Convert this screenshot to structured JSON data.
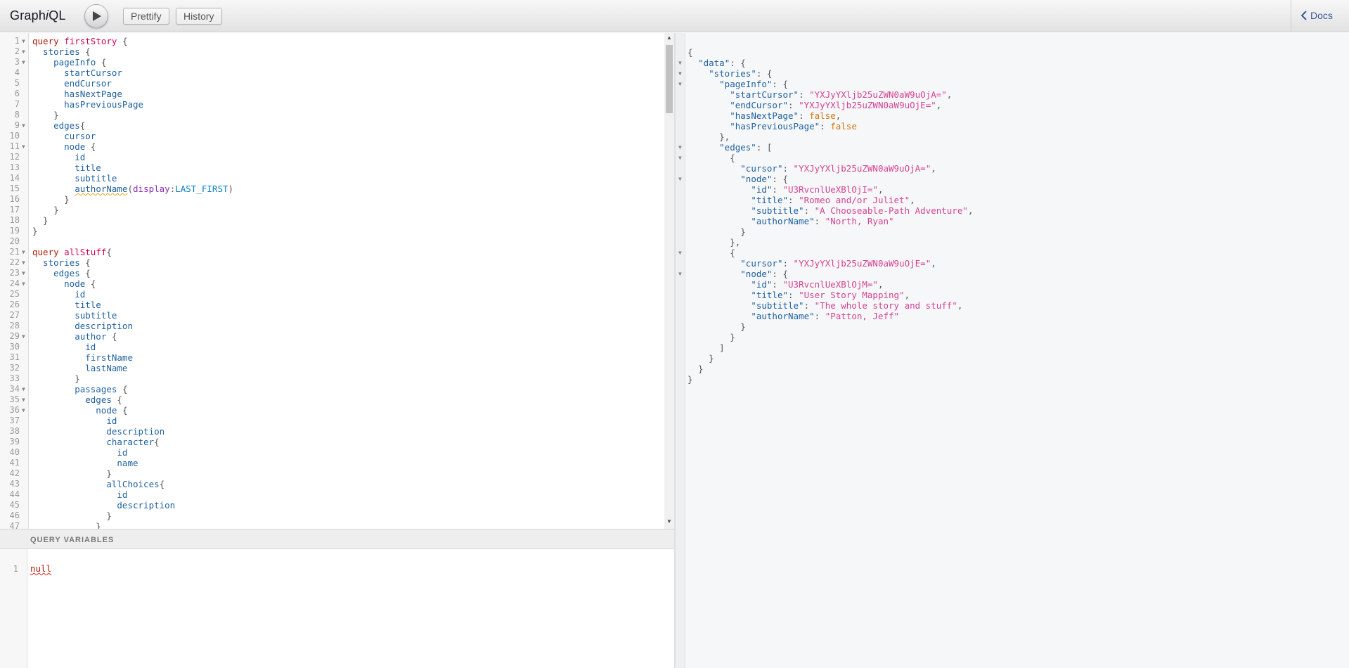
{
  "app": {
    "title_prefix": "Graph",
    "title_i": "i",
    "title_suffix": "QL"
  },
  "toolbar": {
    "prettify_label": "Prettify",
    "history_label": "History",
    "docs_label": "Docs"
  },
  "query_editor": {
    "lines": [
      {
        "n": "1",
        "fold": true,
        "tokens": [
          [
            "kw",
            "query"
          ],
          [
            "",
            " "
          ],
          [
            "def",
            "firstStory"
          ],
          [
            "pn",
            " {"
          ]
        ]
      },
      {
        "n": "2",
        "fold": true,
        "tokens": [
          [
            "",
            "  stories"
          ],
          [
            "pn",
            " {"
          ]
        ]
      },
      {
        "n": "3",
        "fold": true,
        "tokens": [
          [
            "",
            "    pageInfo"
          ],
          [
            "pn",
            " {"
          ]
        ]
      },
      {
        "n": "4",
        "fold": false,
        "tokens": [
          [
            "",
            "      startCursor"
          ]
        ]
      },
      {
        "n": "5",
        "fold": false,
        "tokens": [
          [
            "",
            "      endCursor"
          ]
        ]
      },
      {
        "n": "6",
        "fold": false,
        "tokens": [
          [
            "",
            "      hasNextPage"
          ]
        ]
      },
      {
        "n": "7",
        "fold": false,
        "tokens": [
          [
            "",
            "      hasPreviousPage"
          ]
        ]
      },
      {
        "n": "8",
        "fold": false,
        "tokens": [
          [
            "pn",
            "    }"
          ]
        ]
      },
      {
        "n": "9",
        "fold": true,
        "tokens": [
          [
            "",
            "    edges"
          ],
          [
            "pn",
            "{"
          ]
        ]
      },
      {
        "n": "10",
        "fold": false,
        "tokens": [
          [
            "",
            "      cursor"
          ]
        ]
      },
      {
        "n": "11",
        "fold": true,
        "tokens": [
          [
            "",
            "      node"
          ],
          [
            "pn",
            " {"
          ]
        ]
      },
      {
        "n": "12",
        "fold": false,
        "tokens": [
          [
            "",
            "        id"
          ]
        ]
      },
      {
        "n": "13",
        "fold": false,
        "tokens": [
          [
            "",
            "        title"
          ]
        ]
      },
      {
        "n": "14",
        "fold": false,
        "tokens": [
          [
            "",
            "        subtitle"
          ]
        ]
      },
      {
        "n": "15",
        "fold": false,
        "tokens": [
          [
            "",
            "        "
          ],
          [
            "err",
            "authorName"
          ],
          [
            "pn",
            "("
          ],
          [
            "arg",
            "display"
          ],
          [
            "pn",
            ":"
          ],
          [
            "en",
            "LAST_FIRST"
          ],
          [
            "pn",
            ")"
          ]
        ]
      },
      {
        "n": "16",
        "fold": false,
        "tokens": [
          [
            "pn",
            "      }"
          ]
        ]
      },
      {
        "n": "17",
        "fold": false,
        "tokens": [
          [
            "pn",
            "    }"
          ]
        ]
      },
      {
        "n": "18",
        "fold": false,
        "tokens": [
          [
            "pn",
            "  }"
          ]
        ]
      },
      {
        "n": "19",
        "fold": false,
        "tokens": [
          [
            "pn",
            "}"
          ]
        ]
      },
      {
        "n": "20",
        "fold": false,
        "tokens": []
      },
      {
        "n": "21",
        "fold": true,
        "tokens": [
          [
            "kw",
            "query"
          ],
          [
            "",
            " "
          ],
          [
            "def",
            "allStuff"
          ],
          [
            "pn",
            "{"
          ]
        ]
      },
      {
        "n": "22",
        "fold": true,
        "tokens": [
          [
            "",
            "  stories"
          ],
          [
            "pn",
            " {"
          ]
        ]
      },
      {
        "n": "23",
        "fold": true,
        "tokens": [
          [
            "",
            "    edges"
          ],
          [
            "pn",
            " {"
          ]
        ]
      },
      {
        "n": "24",
        "fold": true,
        "tokens": [
          [
            "",
            "      node"
          ],
          [
            "pn",
            " {"
          ]
        ]
      },
      {
        "n": "25",
        "fold": false,
        "tokens": [
          [
            "",
            "        id"
          ]
        ]
      },
      {
        "n": "26",
        "fold": false,
        "tokens": [
          [
            "",
            "        title"
          ]
        ]
      },
      {
        "n": "27",
        "fold": false,
        "tokens": [
          [
            "",
            "        subtitle"
          ]
        ]
      },
      {
        "n": "28",
        "fold": false,
        "tokens": [
          [
            "",
            "        description"
          ]
        ]
      },
      {
        "n": "29",
        "fold": true,
        "tokens": [
          [
            "",
            "        author"
          ],
          [
            "pn",
            " {"
          ]
        ]
      },
      {
        "n": "30",
        "fold": false,
        "tokens": [
          [
            "",
            "          id"
          ]
        ]
      },
      {
        "n": "31",
        "fold": false,
        "tokens": [
          [
            "",
            "          firstName"
          ]
        ]
      },
      {
        "n": "32",
        "fold": false,
        "tokens": [
          [
            "",
            "          lastName"
          ]
        ]
      },
      {
        "n": "33",
        "fold": false,
        "tokens": [
          [
            "pn",
            "        }"
          ]
        ]
      },
      {
        "n": "34",
        "fold": true,
        "tokens": [
          [
            "",
            "        passages"
          ],
          [
            "pn",
            " {"
          ]
        ]
      },
      {
        "n": "35",
        "fold": true,
        "tokens": [
          [
            "",
            "          edges"
          ],
          [
            "pn",
            " {"
          ]
        ]
      },
      {
        "n": "36",
        "fold": true,
        "tokens": [
          [
            "",
            "            node"
          ],
          [
            "pn",
            " {"
          ]
        ]
      },
      {
        "n": "37",
        "fold": false,
        "tokens": [
          [
            "",
            "              id"
          ]
        ]
      },
      {
        "n": "38",
        "fold": false,
        "tokens": [
          [
            "",
            "              description"
          ]
        ]
      },
      {
        "n": "39",
        "fold": false,
        "tokens": [
          [
            "",
            "              character"
          ],
          [
            "pn",
            "{"
          ]
        ]
      },
      {
        "n": "40",
        "fold": false,
        "tokens": [
          [
            "",
            "                id"
          ]
        ]
      },
      {
        "n": "41",
        "fold": false,
        "tokens": [
          [
            "",
            "                name"
          ]
        ]
      },
      {
        "n": "42",
        "fold": false,
        "tokens": [
          [
            "pn",
            "              }"
          ]
        ]
      },
      {
        "n": "43",
        "fold": false,
        "tokens": [
          [
            "",
            "              allChoices"
          ],
          [
            "pn",
            "{"
          ]
        ]
      },
      {
        "n": "44",
        "fold": false,
        "tokens": [
          [
            "",
            "                id"
          ]
        ]
      },
      {
        "n": "45",
        "fold": false,
        "tokens": [
          [
            "",
            "                description"
          ]
        ]
      },
      {
        "n": "46",
        "fold": false,
        "tokens": [
          [
            "pn",
            "              }"
          ]
        ]
      },
      {
        "n": "47",
        "fold": false,
        "tokens": [
          [
            "pn",
            "            }"
          ]
        ]
      }
    ]
  },
  "variables": {
    "header": "QUERY VARIABLES",
    "line_number": "1",
    "value": "null"
  },
  "result": {
    "lines": [
      {
        "fold": false,
        "tokens": [
          [
            "",
            "{"
          ]
        ]
      },
      {
        "fold": true,
        "tokens": [
          [
            "",
            "  "
          ],
          [
            "rkey",
            "\"data\""
          ],
          [
            "",
            ": {"
          ]
        ]
      },
      {
        "fold": true,
        "tokens": [
          [
            "",
            "    "
          ],
          [
            "rkey",
            "\"stories\""
          ],
          [
            "",
            ": {"
          ]
        ]
      },
      {
        "fold": true,
        "tokens": [
          [
            "",
            "      "
          ],
          [
            "rkey",
            "\"pageInfo\""
          ],
          [
            "",
            ": {"
          ]
        ]
      },
      {
        "fold": false,
        "tokens": [
          [
            "",
            "        "
          ],
          [
            "rkey",
            "\"startCursor\""
          ],
          [
            "",
            ": "
          ],
          [
            "rstr",
            "\"YXJyYXljb25uZWN0aW9uOjA=\""
          ],
          [
            "",
            ","
          ]
        ]
      },
      {
        "fold": false,
        "tokens": [
          [
            "",
            "        "
          ],
          [
            "rkey",
            "\"endCursor\""
          ],
          [
            "",
            ": "
          ],
          [
            "rstr",
            "\"YXJyYXljb25uZWN0aW9uOjE=\""
          ],
          [
            "",
            ","
          ]
        ]
      },
      {
        "fold": false,
        "tokens": [
          [
            "",
            "        "
          ],
          [
            "rkey",
            "\"hasNextPage\""
          ],
          [
            "",
            ": "
          ],
          [
            "rbool",
            "false"
          ],
          [
            "",
            ","
          ]
        ]
      },
      {
        "fold": false,
        "tokens": [
          [
            "",
            "        "
          ],
          [
            "rkey",
            "\"hasPreviousPage\""
          ],
          [
            "",
            ": "
          ],
          [
            "rbool",
            "false"
          ]
        ]
      },
      {
        "fold": false,
        "tokens": [
          [
            "",
            "      },"
          ]
        ]
      },
      {
        "fold": true,
        "tokens": [
          [
            "",
            "      "
          ],
          [
            "rkey",
            "\"edges\""
          ],
          [
            "",
            ": ["
          ]
        ]
      },
      {
        "fold": true,
        "tokens": [
          [
            "",
            "        {"
          ]
        ]
      },
      {
        "fold": false,
        "tokens": [
          [
            "",
            "          "
          ],
          [
            "rkey",
            "\"cursor\""
          ],
          [
            "",
            ": "
          ],
          [
            "rstr",
            "\"YXJyYXljb25uZWN0aW9uOjA=\""
          ],
          [
            "",
            ","
          ]
        ]
      },
      {
        "fold": true,
        "tokens": [
          [
            "",
            "          "
          ],
          [
            "rkey",
            "\"node\""
          ],
          [
            "",
            ": {"
          ]
        ]
      },
      {
        "fold": false,
        "tokens": [
          [
            "",
            "            "
          ],
          [
            "rkey",
            "\"id\""
          ],
          [
            "",
            ": "
          ],
          [
            "rstr",
            "\"U3RvcnlUeXBlOjI=\""
          ],
          [
            "",
            ","
          ]
        ]
      },
      {
        "fold": false,
        "tokens": [
          [
            "",
            "            "
          ],
          [
            "rkey",
            "\"title\""
          ],
          [
            "",
            ": "
          ],
          [
            "rstr",
            "\"Romeo and/or Juliet\""
          ],
          [
            "",
            ","
          ]
        ]
      },
      {
        "fold": false,
        "tokens": [
          [
            "",
            "            "
          ],
          [
            "rkey",
            "\"subtitle\""
          ],
          [
            "",
            ": "
          ],
          [
            "rstr",
            "\"A Chooseable-Path Adventure\""
          ],
          [
            "",
            ","
          ]
        ]
      },
      {
        "fold": false,
        "tokens": [
          [
            "",
            "            "
          ],
          [
            "rkey",
            "\"authorName\""
          ],
          [
            "",
            ": "
          ],
          [
            "rstr",
            "\"North, Ryan\""
          ]
        ]
      },
      {
        "fold": false,
        "tokens": [
          [
            "",
            "          }"
          ]
        ]
      },
      {
        "fold": false,
        "tokens": [
          [
            "",
            "        },"
          ]
        ]
      },
      {
        "fold": true,
        "tokens": [
          [
            "",
            "        {"
          ]
        ]
      },
      {
        "fold": false,
        "tokens": [
          [
            "",
            "          "
          ],
          [
            "rkey",
            "\"cursor\""
          ],
          [
            "",
            ": "
          ],
          [
            "rstr",
            "\"YXJyYXljb25uZWN0aW9uOjE=\""
          ],
          [
            "",
            ","
          ]
        ]
      },
      {
        "fold": true,
        "tokens": [
          [
            "",
            "          "
          ],
          [
            "rkey",
            "\"node\""
          ],
          [
            "",
            ": {"
          ]
        ]
      },
      {
        "fold": false,
        "tokens": [
          [
            "",
            "            "
          ],
          [
            "rkey",
            "\"id\""
          ],
          [
            "",
            ": "
          ],
          [
            "rstr",
            "\"U3RvcnlUeXBlOjM=\""
          ],
          [
            "",
            ","
          ]
        ]
      },
      {
        "fold": false,
        "tokens": [
          [
            "",
            "            "
          ],
          [
            "rkey",
            "\"title\""
          ],
          [
            "",
            ": "
          ],
          [
            "rstr",
            "\"User Story Mapping\""
          ],
          [
            "",
            ","
          ]
        ]
      },
      {
        "fold": false,
        "tokens": [
          [
            "",
            "            "
          ],
          [
            "rkey",
            "\"subtitle\""
          ],
          [
            "",
            ": "
          ],
          [
            "rstr",
            "\"The whole story and stuff\""
          ],
          [
            "",
            ","
          ]
        ]
      },
      {
        "fold": false,
        "tokens": [
          [
            "",
            "            "
          ],
          [
            "rkey",
            "\"authorName\""
          ],
          [
            "",
            ": "
          ],
          [
            "rstr",
            "\"Patton, Jeff\""
          ]
        ]
      },
      {
        "fold": false,
        "tokens": [
          [
            "",
            "          }"
          ]
        ]
      },
      {
        "fold": false,
        "tokens": [
          [
            "",
            "        }"
          ]
        ]
      },
      {
        "fold": false,
        "tokens": [
          [
            "",
            "      ]"
          ]
        ]
      },
      {
        "fold": false,
        "tokens": [
          [
            "",
            "    }"
          ]
        ]
      },
      {
        "fold": false,
        "tokens": [
          [
            "",
            "  }"
          ]
        ]
      },
      {
        "fold": false,
        "tokens": [
          [
            "",
            "}"
          ]
        ]
      }
    ]
  }
}
